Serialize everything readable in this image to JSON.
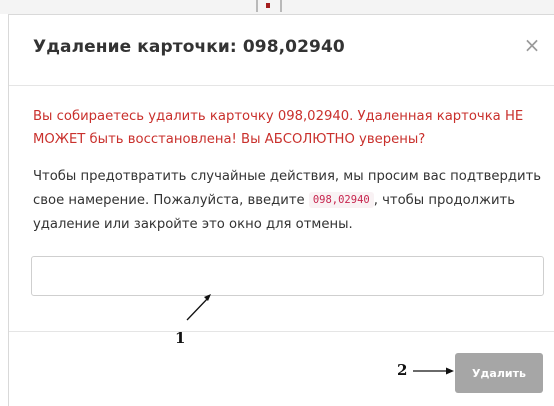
{
  "dialog": {
    "title": "Удаление карточки: 098,02940",
    "close_symbol": "×",
    "warning_text": "Вы собираетесь удалить карточку 098,02940. Удаленная карточка НЕ МОЖЕТ быть восстановлена! Вы АБСОЛЮТНО уверены?",
    "instructions_before": "Чтобы предотвратить случайные действия, мы просим вас подтвердить свое намерение. Пожалуйста, введите ",
    "confirmation_code": "098,02940",
    "instructions_after": ", чтобы продолжить удаление или закройте это окно для отмены.",
    "input": {
      "value": "",
      "placeholder": ""
    },
    "delete_button_label": "Удалить"
  },
  "annotations": {
    "label_1": "1",
    "label_2": "2"
  },
  "colors": {
    "warning": "#c9302c",
    "code_text": "#c7254e",
    "code_bg": "#f9f2f4",
    "disabled_button": "#a6a6a6"
  },
  "icons": {
    "close": "close-icon",
    "arrow_1": "arrow-icon",
    "arrow_2": "arrow-icon"
  }
}
